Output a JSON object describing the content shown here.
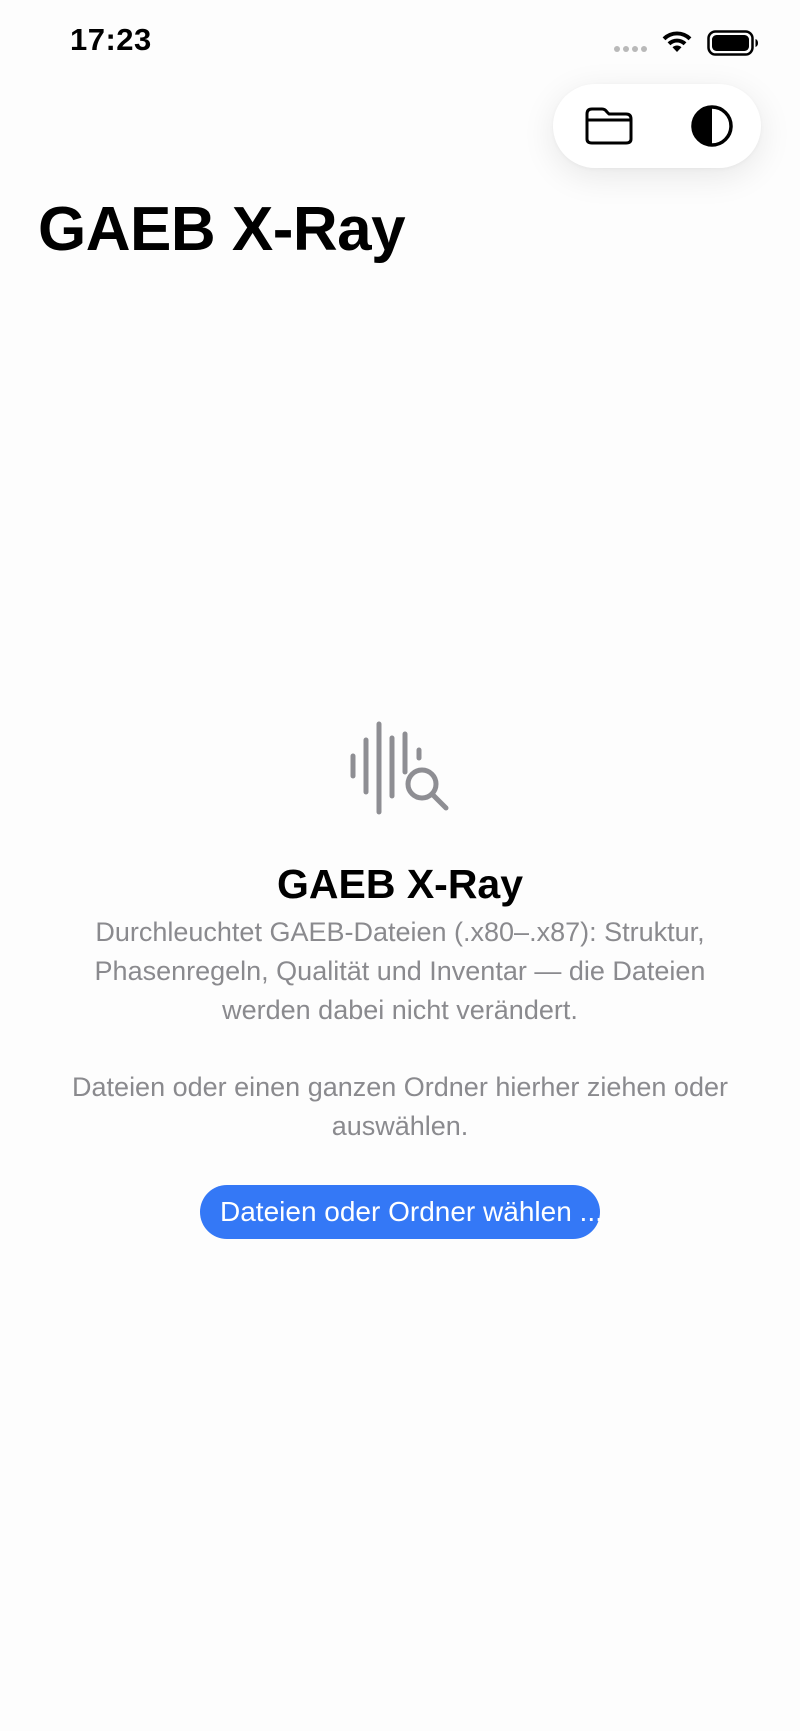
{
  "status_bar": {
    "time": "17:23",
    "icons": [
      "cellular-signal-icon",
      "wifi-icon",
      "battery-icon"
    ]
  },
  "toolbar": {
    "buttons": [
      {
        "name": "open-folder-button",
        "icon": "folder-icon"
      },
      {
        "name": "appearance-toggle-button",
        "icon": "contrast-icon"
      }
    ]
  },
  "header": {
    "title": "GAEB X-Ray"
  },
  "empty_state": {
    "icon": "waveform-magnifier-icon",
    "title": "GAEB X-Ray",
    "description": "Durchleuchtet GAEB-Dateien (.x80–.x87): Struktur, Phasenregeln, Qualität und Inventar — die Dateien werden dabei nicht verändert.",
    "hint": "Dateien oder einen ganzen Ordner hierher ziehen oder auswählen.",
    "button_label": "Dateien oder Ordner wählen ..."
  },
  "colors": {
    "accent": "#3478f6",
    "secondary_text": "#8a8a8e",
    "icon_gray": "#8e8e93",
    "background": "#fdfdfd"
  }
}
